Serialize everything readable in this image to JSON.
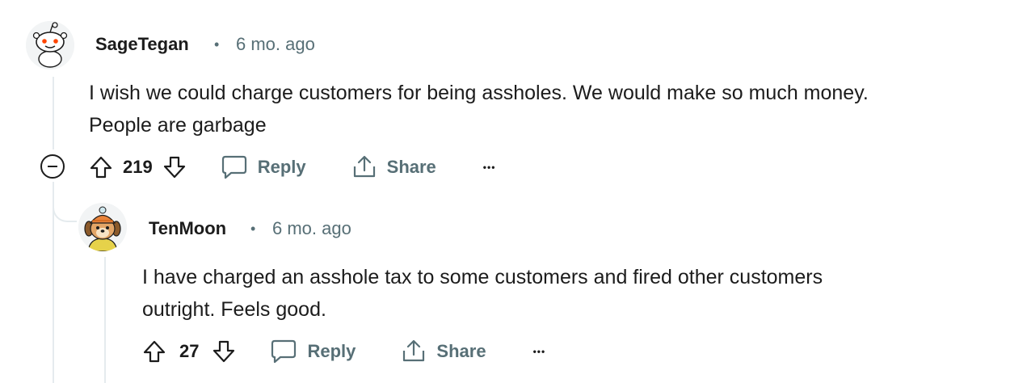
{
  "comments": [
    {
      "author": "SageTegan",
      "separator": "•",
      "time": "6 mo. ago",
      "body_lines": [
        "I wish we could charge customers for being assholes. We would make so much money.",
        "People are garbage"
      ],
      "votes": "219",
      "reply_label": "Reply",
      "share_label": "Share",
      "more_label": "•••"
    },
    {
      "author": "TenMoon",
      "separator": "•",
      "time": "6 mo. ago",
      "body_lines": [
        "I have charged an asshole tax to some customers and fired other customers",
        "outright. Feels good."
      ],
      "votes": "27",
      "reply_label": "Reply",
      "share_label": "Share",
      "more_label": "•••"
    }
  ],
  "colors": {
    "text": "#1c1c1c",
    "meta": "#576f76",
    "thread": "#e5ebee",
    "avatar_red": "#ff4500",
    "avatar_orange": "#e8833a"
  },
  "icons": [
    "snoo-avatar-icon",
    "dog-avatar-icon",
    "upvote-icon",
    "downvote-icon",
    "comment-icon",
    "share-icon",
    "collapse-icon"
  ]
}
